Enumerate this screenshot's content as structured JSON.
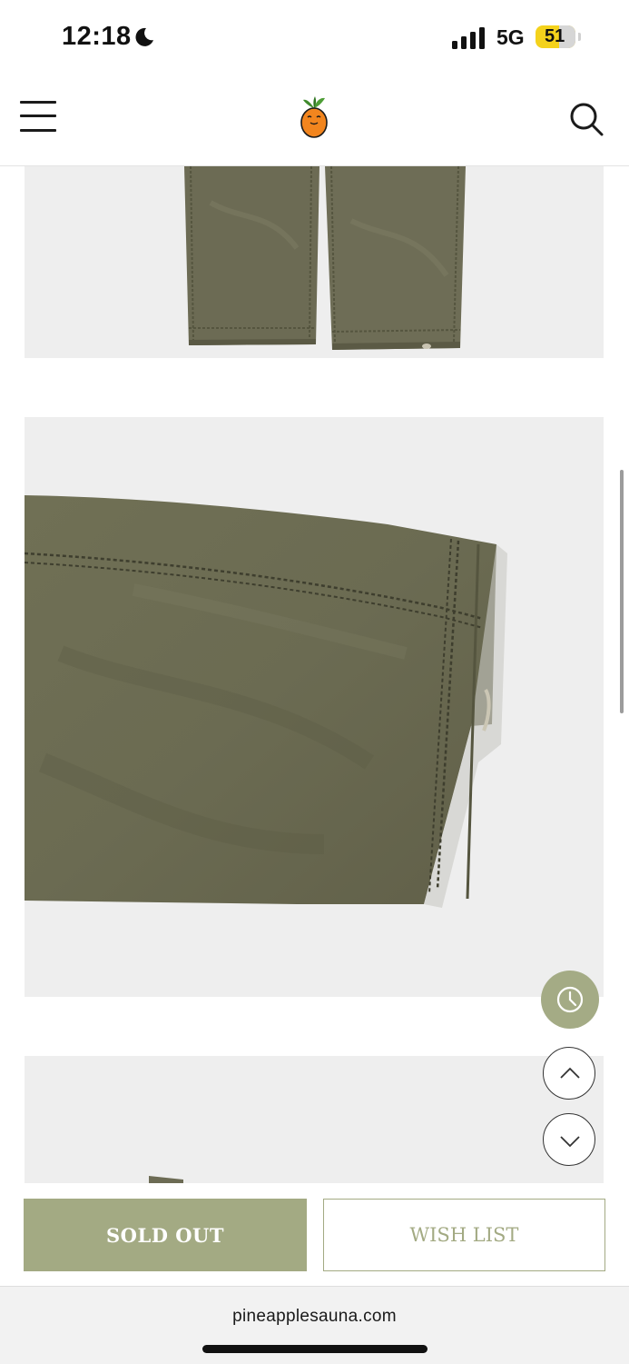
{
  "status_bar": {
    "time": "12:18",
    "network": "5G",
    "battery_level": "51",
    "icons": [
      "moon-icon",
      "signal-icon",
      "battery-icon"
    ]
  },
  "header": {
    "icons": [
      "hamburger-menu-icon",
      "pineapple-logo",
      "search-icon"
    ]
  },
  "gallery": {
    "images": [
      "olive-pants-legs-hem",
      "olive-pants-leg-closeup",
      "olive-pants-partial"
    ]
  },
  "floating_buttons": {
    "icons": [
      "recently-viewed-clock-icon",
      "scroll-up-chevron-icon",
      "scroll-down-chevron-icon"
    ]
  },
  "actions": {
    "sold_out_label": "SOLD OUT",
    "wish_list_label": "WISH LIST"
  },
  "browser": {
    "url": "pineapplesauna.com"
  },
  "colors": {
    "accent": "#a3aa83",
    "battery": "#f4d21c",
    "photo_bg": "#eeeeee",
    "fabric": "#6b6b55"
  }
}
